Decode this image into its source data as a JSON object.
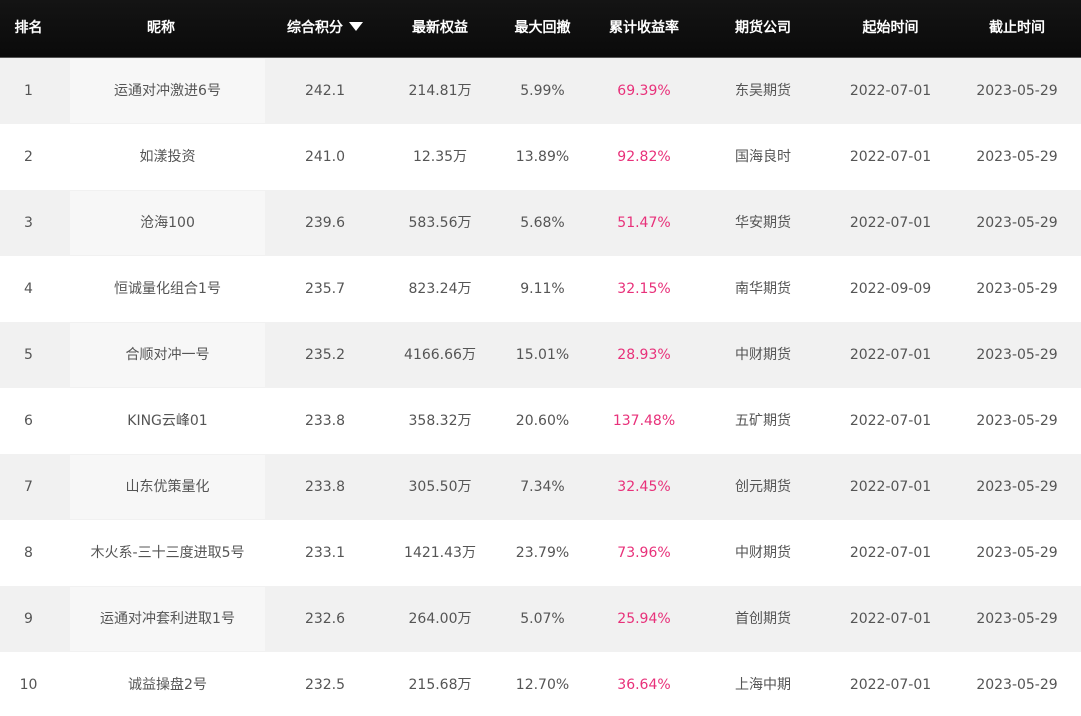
{
  "header": {
    "rank": "排名",
    "name": "昵称",
    "score": "综合积分",
    "equity": "最新权益",
    "drawdown": "最大回撤",
    "return": "累计收益率",
    "company": "期货公司",
    "start": "起始时间",
    "end": "截止时间"
  },
  "colors": {
    "header_bg": "#0a0a0a",
    "return_text": "#e8317a",
    "row_alt": "#f1f1f1"
  },
  "rows": [
    {
      "rank": "1",
      "name": "运通对冲激进6号",
      "score": "242.1",
      "equity": "214.81万",
      "drawdown": "5.99%",
      "return": "69.39%",
      "company": "东吴期货",
      "start": "2022-07-01",
      "end": "2023-05-29"
    },
    {
      "rank": "2",
      "name": "如漾投资",
      "score": "241.0",
      "equity": "12.35万",
      "drawdown": "13.89%",
      "return": "92.82%",
      "company": "国海良时",
      "start": "2022-07-01",
      "end": "2023-05-29"
    },
    {
      "rank": "3",
      "name": "沧海100",
      "score": "239.6",
      "equity": "583.56万",
      "drawdown": "5.68%",
      "return": "51.47%",
      "company": "华安期货",
      "start": "2022-07-01",
      "end": "2023-05-29"
    },
    {
      "rank": "4",
      "name": "恒诚量化组合1号",
      "score": "235.7",
      "equity": "823.24万",
      "drawdown": "9.11%",
      "return": "32.15%",
      "company": "南华期货",
      "start": "2022-09-09",
      "end": "2023-05-29"
    },
    {
      "rank": "5",
      "name": "合顺对冲一号",
      "score": "235.2",
      "equity": "4166.66万",
      "drawdown": "15.01%",
      "return": "28.93%",
      "company": "中财期货",
      "start": "2022-07-01",
      "end": "2023-05-29"
    },
    {
      "rank": "6",
      "name": "KING云峰01",
      "score": "233.8",
      "equity": "358.32万",
      "drawdown": "20.60%",
      "return": "137.48%",
      "company": "五矿期货",
      "start": "2022-07-01",
      "end": "2023-05-29"
    },
    {
      "rank": "7",
      "name": "山东优策量化",
      "score": "233.8",
      "equity": "305.50万",
      "drawdown": "7.34%",
      "return": "32.45%",
      "company": "创元期货",
      "start": "2022-07-01",
      "end": "2023-05-29"
    },
    {
      "rank": "8",
      "name": "木火系-三十三度进取5号",
      "score": "233.1",
      "equity": "1421.43万",
      "drawdown": "23.79%",
      "return": "73.96%",
      "company": "中财期货",
      "start": "2022-07-01",
      "end": "2023-05-29"
    },
    {
      "rank": "9",
      "name": "运通对冲套利进取1号",
      "score": "232.6",
      "equity": "264.00万",
      "drawdown": "5.07%",
      "return": "25.94%",
      "company": "首创期货",
      "start": "2022-07-01",
      "end": "2023-05-29"
    },
    {
      "rank": "10",
      "name": "诚益操盘2号",
      "score": "232.5",
      "equity": "215.68万",
      "drawdown": "12.70%",
      "return": "36.64%",
      "company": "上海中期",
      "start": "2022-07-01",
      "end": "2023-05-29"
    }
  ]
}
